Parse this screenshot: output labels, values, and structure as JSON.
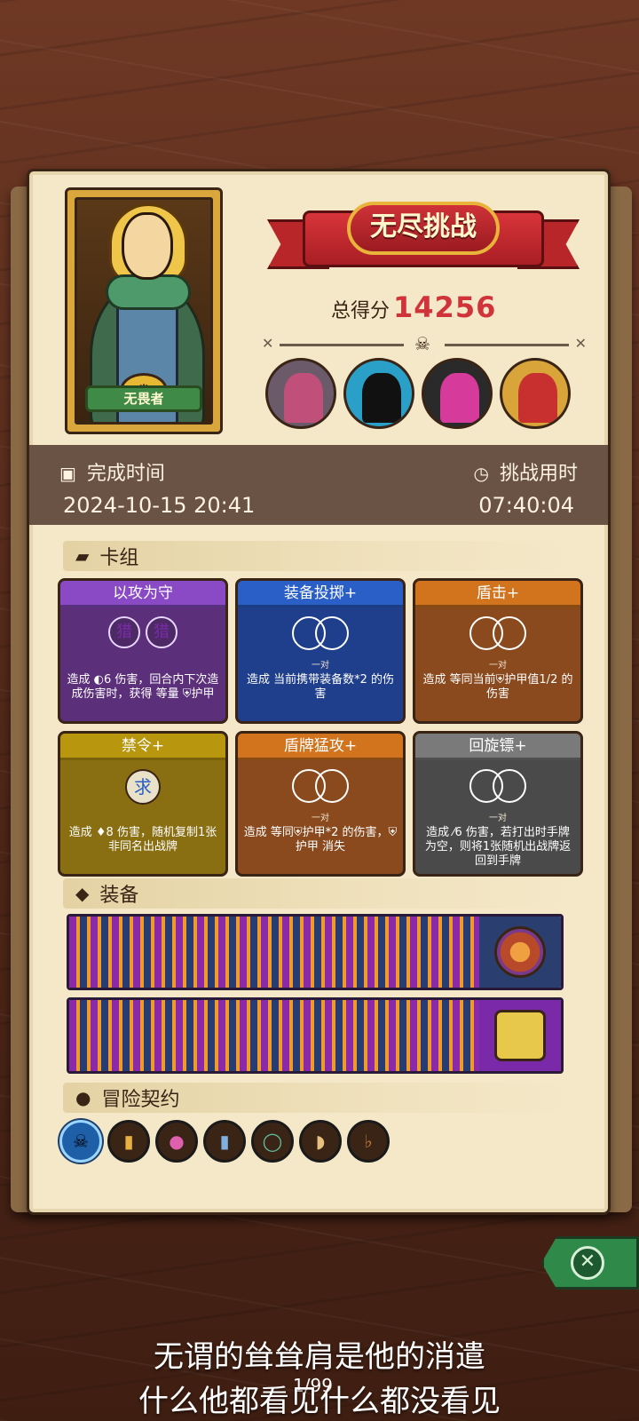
{
  "hero": {
    "name": "无畏者",
    "crown_icon": "crown-icon"
  },
  "header": {
    "banner_title": "无尽挑战",
    "score_label": "总得分",
    "score_value": "14256"
  },
  "times": {
    "completed_label": "完成时间",
    "completed_value": "2024-10-15 20:41",
    "duration_label": "挑战用时",
    "duration_value": "07:40:04"
  },
  "sections": {
    "deck": "卡组",
    "equipment": "装备",
    "contracts": "冒险契约"
  },
  "cards": [
    {
      "title": "以攻为守",
      "tag": "",
      "desc": "造成 ◐6 伤害，回合内下次造成伤害时，获得 等量 ⛨护甲",
      "color": "purple"
    },
    {
      "title": "装备投掷+",
      "tag": "一对",
      "desc": "造成 当前携带装备数*2 的伤害",
      "color": "blue"
    },
    {
      "title": "盾击+",
      "tag": "一对",
      "desc": "造成 等同当前⛨护甲值1/2 的伤害",
      "color": "orange"
    },
    {
      "title": "禁令+",
      "tag": "",
      "desc": "造成 ♦8 伤害，随机复制1张非同名出战牌",
      "color": "olive"
    },
    {
      "title": "盾牌猛攻+",
      "tag": "一对",
      "desc": "造成 等同⛨护甲*2 的伤害，⛨护甲 消失",
      "color": "orange2"
    },
    {
      "title": "回旋镖+",
      "tag": "一对",
      "desc": "造成 ⁄6 伤害，若打出时手牌为空，则将1张随机出战牌返回到手牌",
      "color": "gray"
    }
  ],
  "purple_emblem": "猎",
  "olive_emblem": "求",
  "equipment": [
    {
      "icon": "round-shield-icon"
    },
    {
      "icon": "golden-dice-icon"
    }
  ],
  "contract_icons": [
    "blue-flame-skull-icon",
    "scroll-icon",
    "pink-orb-icon",
    "blue-tag-icon",
    "green-ring-icon",
    "horn-icon",
    "pipe-icon"
  ],
  "subtitles": {
    "line1": "无谓的耸耸肩是他的消遣",
    "line2": "什么他都看见什么都没看见"
  },
  "pager": "1/99"
}
